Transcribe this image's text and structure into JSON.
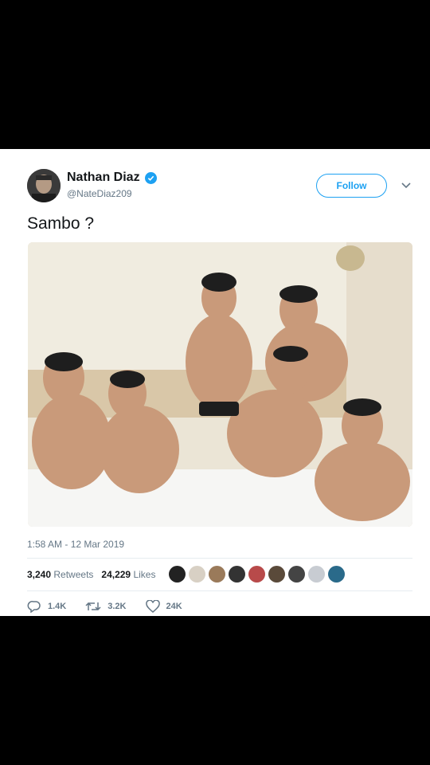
{
  "tweet": {
    "display_name": "Nathan Diaz",
    "handle": "@NateDiaz209",
    "follow_label": "Follow",
    "text": "Sambo ?",
    "timestamp": "1:58 AM - 12 Mar 2019",
    "retweets_count": "3,240",
    "retweets_label": "Retweets",
    "likes_count": "24,229",
    "likes_label": "Likes",
    "replies": "1.4K",
    "retweets_short": "3.2K",
    "likes_short": "24K"
  },
  "icons": {
    "verified": "verified-badge-icon",
    "more": "chevron-down-icon",
    "reply": "reply-icon",
    "retweet": "retweet-icon",
    "like": "heart-icon"
  },
  "colors": {
    "accent": "#1da1f2",
    "text": "#14171a",
    "muted": "#657786",
    "background": "#000000"
  },
  "likers": [
    {
      "color": "#222222"
    },
    {
      "color": "#d8d0c4"
    },
    {
      "color": "#9a7a5a"
    },
    {
      "color": "#333333"
    },
    {
      "color": "#b84a4a"
    },
    {
      "color": "#5a4a3a"
    },
    {
      "color": "#444444"
    },
    {
      "color": "#c8ccd2"
    },
    {
      "color": "#2a6a8a"
    }
  ]
}
